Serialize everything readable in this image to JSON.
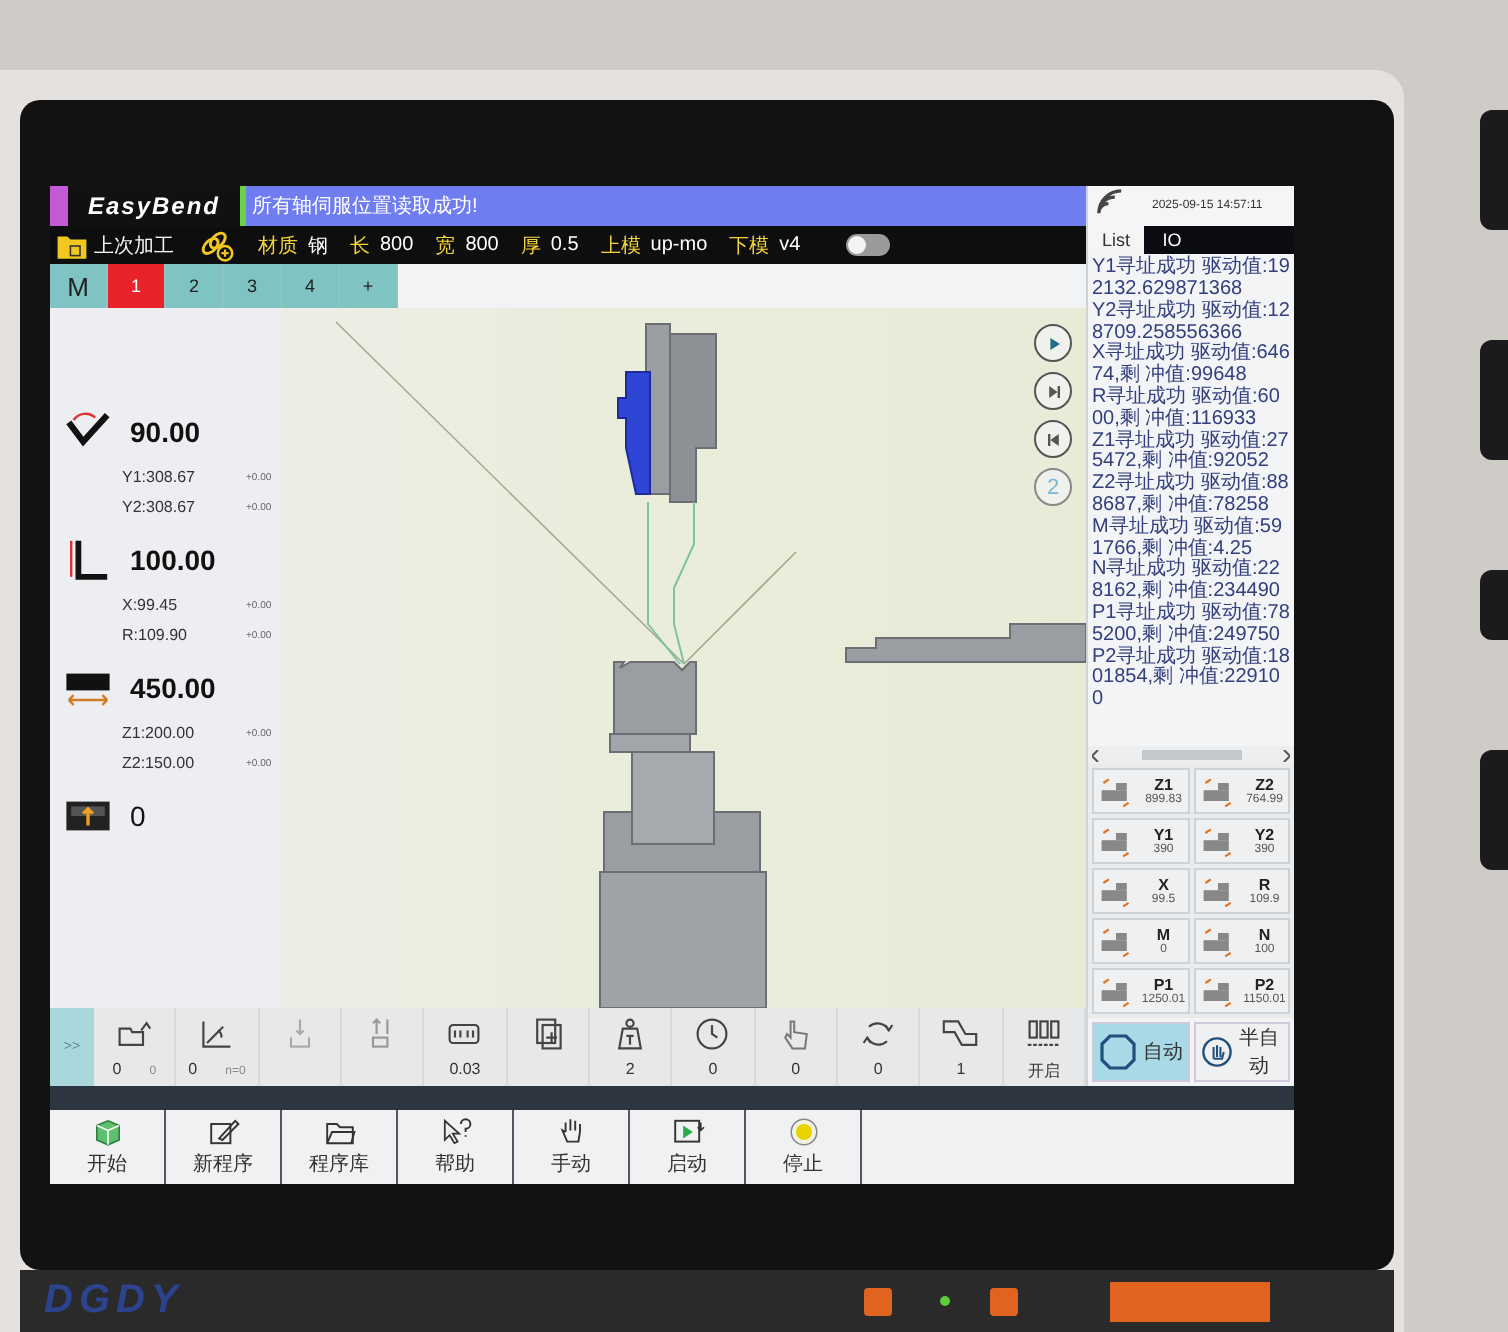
{
  "device": {
    "logo": "DGDY"
  },
  "screen": {
    "brand": "EasyBend",
    "message": "所有轴伺服位置读取成功!",
    "last_job": "上次加工",
    "params": [
      {
        "label": "材质",
        "value": "钢"
      },
      {
        "label": "长",
        "value": "800"
      },
      {
        "label": "宽",
        "value": "800"
      },
      {
        "label": "厚",
        "value": "0.5"
      },
      {
        "label": "上模",
        "value": "up-mo"
      },
      {
        "label": "下模",
        "value": "v4"
      }
    ],
    "toggle": {
      "on": false
    },
    "step_tabs": [
      {
        "label": "M",
        "selected": false
      },
      {
        "label": "1",
        "selected": true
      },
      {
        "label": "2",
        "selected": false
      },
      {
        "label": "3",
        "selected": false
      },
      {
        "label": "4",
        "selected": false
      },
      {
        "label": "+",
        "selected": false
      }
    ],
    "readouts": [
      {
        "kind": "angle",
        "value": "90.00",
        "axes": [
          {
            "label": "Y1:308.67",
            "offset": "+0.00"
          },
          {
            "label": "Y2:308.67",
            "offset": "+0.00"
          }
        ]
      },
      {
        "kind": "length",
        "value": "100.00",
        "axes": [
          {
            "label": "X:99.45",
            "offset": "+0.00"
          },
          {
            "label": "R:109.90",
            "offset": "+0.00"
          }
        ]
      },
      {
        "kind": "width",
        "value": "450.00",
        "axes": [
          {
            "label": "Z1:200.00",
            "offset": "+0.00"
          },
          {
            "label": "Z2:150.00",
            "offset": "+0.00"
          }
        ]
      },
      {
        "kind": "count",
        "value": "0"
      }
    ],
    "playback": [
      {
        "kind": "play"
      },
      {
        "kind": "next"
      },
      {
        "kind": "prev"
      },
      {
        "kind": "step",
        "label": "2"
      }
    ],
    "expand": ">>",
    "status_cells": [
      {
        "kind": "folder",
        "value": "0",
        "extra": "0"
      },
      {
        "kind": "graph",
        "value": "0",
        "extra": "n=0"
      },
      {
        "kind": "press"
      },
      {
        "kind": "pressup"
      },
      {
        "kind": "meter",
        "value": "0.03"
      },
      {
        "kind": "copy"
      },
      {
        "kind": "weight",
        "value": "2"
      },
      {
        "kind": "clock",
        "value": "0"
      },
      {
        "kind": "hand",
        "value": "0"
      },
      {
        "kind": "cycle",
        "value": "0"
      },
      {
        "kind": "part",
        "value": "1"
      },
      {
        "kind": "clamps",
        "value": "开启"
      }
    ],
    "datetime": "2025-09-15 14:57:11",
    "panel_tabs": [
      {
        "label": "List",
        "selected": true
      },
      {
        "label": "IO",
        "selected": false
      }
    ],
    "log": [
      "Y1寻址成功 驱动值:192132.629871368",
      "Y2寻址成功 驱动值:128709.258556366",
      "X寻址成功 驱动值:64674,剩 冲值:99648",
      "R寻址成功 驱动值:6000,剩 冲值:116933",
      "Z1寻址成功 驱动值:275472,剩 冲值:92052",
      "Z2寻址成功 驱动值:888687,剩 冲值:78258",
      "M寻址成功 驱动值:591766,剩 冲值:4.25",
      "N寻址成功 驱动值:228162,剩 冲值:234490",
      "P1寻址成功 驱动值:785200,剩 冲值:249750",
      "P2寻址成功 驱动值:1801854,剩 冲值:229100"
    ],
    "axes": [
      {
        "name": "Z1",
        "value": "899.83"
      },
      {
        "name": "Z2",
        "value": "764.99"
      },
      {
        "name": "Y1",
        "value": "390"
      },
      {
        "name": "Y2",
        "value": "390"
      },
      {
        "name": "X",
        "value": "99.5"
      },
      {
        "name": "R",
        "value": "109.9"
      },
      {
        "name": "M",
        "value": "0"
      },
      {
        "name": "N",
        "value": "100"
      },
      {
        "name": "P1",
        "value": "1250.01"
      },
      {
        "name": "P2",
        "value": "1150.01"
      }
    ],
    "modes": [
      {
        "kind": "auto",
        "label": "自动",
        "selected": true
      },
      {
        "kind": "semi",
        "label": "半自动",
        "selected": false
      }
    ],
    "nav": [
      {
        "kind": "start",
        "label": "开始"
      },
      {
        "kind": "new",
        "label": "新程序"
      },
      {
        "kind": "library",
        "label": "程序库"
      },
      {
        "kind": "help",
        "label": "帮助"
      },
      {
        "kind": "manual",
        "label": "手动"
      },
      {
        "kind": "run",
        "label": "启动"
      },
      {
        "kind": "stop",
        "label": "停止"
      }
    ]
  }
}
